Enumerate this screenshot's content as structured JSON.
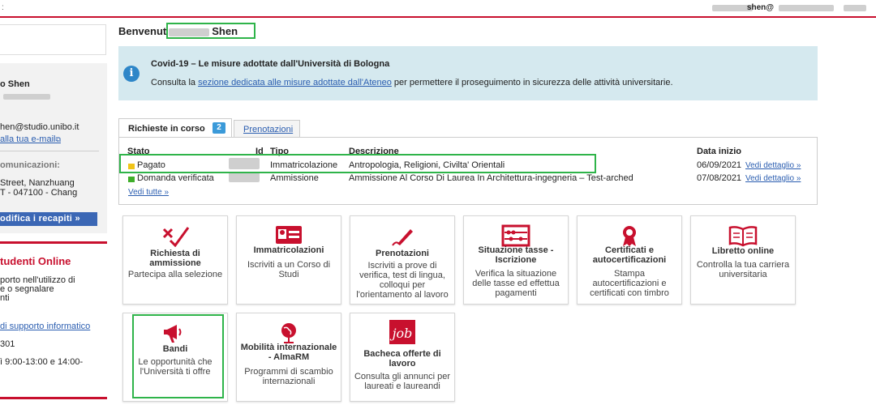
{
  "topbar": {
    "left_text": ":",
    "user": "shen@"
  },
  "sidebar": {
    "name": "o Shen",
    "email": "hen@studio.unibo.it",
    "email_link": " alla tua e-mail",
    "comm_label": "omunicazioni:",
    "address_line1": " Street, Nanzhuang",
    "address_line2": "T - 047100 - Chang",
    "modify_button": "odifica i recapiti »",
    "students_online": "tudenti Online",
    "support_line1": "porto nell'utilizzo di",
    "support_line2": "e o segnalare",
    "support_line3": "nti",
    "support_link": "di supporto informatico",
    "phone": "301",
    "hours": "ì 9:00-13:00 e 14:00-"
  },
  "welcome": {
    "prefix": "Benvenut",
    "surname": "Shen"
  },
  "covid": {
    "title": "Covid-19 – Le misure adottate dall'Università di Bologna",
    "text_before": "Consulta la ",
    "link": "sezione dedicata alle misure adottate dall'Ateneo",
    "text_after": " per permettere il proseguimento in sicurezza delle attività universitarie."
  },
  "tabs": {
    "active_label": "Richieste in corso",
    "active_count": "2",
    "second_label": "Prenotazioni"
  },
  "requests": {
    "headers": {
      "stato": "Stato",
      "id": "Id",
      "tipo": "Tipo",
      "descrizione": "Descrizione",
      "data": "Data inizio"
    },
    "rows": [
      {
        "stato": "Pagato",
        "tipo": "Immatricolazione",
        "descrizione": "Antropologia, Religioni, Civilta' Orientali",
        "data": "06/09/2021",
        "link": "Vedi dettaglio »",
        "status_color": "#f0c419"
      },
      {
        "stato": "Domanda verificata",
        "tipo": "Ammissione",
        "descrizione": "Ammissione Al Corso Di Laurea In Architettura-ingegneria – Test-arched",
        "data": "07/08/2021",
        "link": "Vedi dettaglio »",
        "status_color": "#3fae2a"
      }
    ],
    "see_all": "Vedi tutte »"
  },
  "tiles": [
    {
      "title": "Richiesta di ammissione",
      "desc": "Partecipa alla selezione",
      "icon": "check-icon"
    },
    {
      "title": "Immatricolazioni",
      "desc": "Iscriviti a un Corso di Studi",
      "icon": "id-card-icon"
    },
    {
      "title": "Prenotazioni",
      "desc": "Iscriviti a prove di verifica, test di lingua, colloqui per l'orientamento al lavoro",
      "icon": "pen-icon"
    },
    {
      "title": "Situazione tasse - Iscrizione",
      "desc": "Verifica la situazione delle tasse ed effettua pagamenti",
      "icon": "abacus-icon"
    },
    {
      "title": "Certificati e autocertificazioni",
      "desc": "Stampa autocertificazioni e certificati con timbro",
      "icon": "ribbon-icon"
    },
    {
      "title": "Libretto online",
      "desc": "Controlla la tua carriera universitaria",
      "icon": "book-icon"
    },
    {
      "title": "Bandi",
      "desc": "Le opportunità che l'Università ti offre",
      "icon": "megaphone-icon"
    },
    {
      "title": "Mobilità internazionale - AlmaRM",
      "desc": "Programmi di scambio internazionali",
      "icon": "globe-icon"
    },
    {
      "title": "Bacheca offerte di lavoro",
      "desc": "Consulta gli annunci per laureati e laureandi",
      "icon": "job-board-icon"
    }
  ],
  "colors": {
    "brand_red": "#c8102e",
    "link_blue": "#2a5db0",
    "highlight_green": "#2fb44a",
    "info_bg": "#d5e9ef"
  }
}
